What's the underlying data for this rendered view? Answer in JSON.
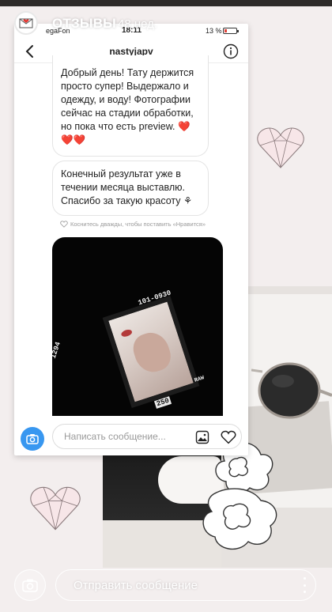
{
  "story": {
    "title": "ОТЗЫВЫ",
    "time": "48 нед.",
    "reply_placeholder": "Отправить сообщение"
  },
  "status_bar": {
    "carrier": "egaFon",
    "clock": "18:11",
    "battery": "13 %"
  },
  "chat": {
    "username": "nastyjapv",
    "messages": [
      {
        "text": "Добрый день! Тату держится просто супер! Выдержало и одежду, и воду! Фотографии сейчас на стадии обработки, но пока что есть preview.",
        "emoji": "❤️❤️❤️"
      },
      {
        "text": "Конечный результат уже в течении месяца выставлю. Спасибо за такую красоту",
        "emoji": "⚘"
      }
    ],
    "like_hint": "Коснитесь дважды, чтобы поставить «Нравится»",
    "photo_codes": [
      "101-0930",
      "1294",
      "250",
      "RAW"
    ],
    "composer_placeholder": "Написать сообщение..."
  },
  "colors": {
    "accent_blue": "#3897f0",
    "heart_red": "#e3342f",
    "deco_heart_fill": "#f7e6e8"
  },
  "icons": {
    "story_avatar": "envelope-heart-icon",
    "back": "chevron-left-icon",
    "info": "info-icon",
    "camera": "camera-icon",
    "gallery": "gallery-icon",
    "like": "heart-outline-icon",
    "more": "more-vertical-icon"
  }
}
